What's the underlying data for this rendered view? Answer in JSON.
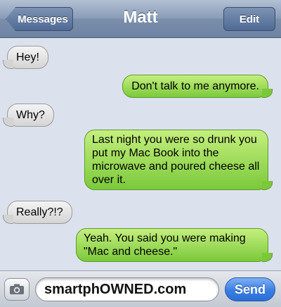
{
  "navbar": {
    "title": "Matt",
    "back_label": "Messages",
    "edit_label": "Edit"
  },
  "messages": [
    {
      "side": "received",
      "text": "Hey!"
    },
    {
      "side": "sent",
      "text": "Don't talk to me anymore."
    },
    {
      "side": "received",
      "text": "Why?"
    },
    {
      "side": "sent",
      "text": "Last night you were so drunk you put my Mac Book into the microwave and poured cheese all over it."
    },
    {
      "side": "received",
      "text": "Really?!?"
    },
    {
      "side": "sent",
      "text": "Yeah. You said you were making \"Mac and cheese.\""
    }
  ],
  "composer": {
    "input_value": "smartphOWNED.com",
    "send_label": "Send",
    "camera_icon": "camera-icon"
  },
  "colors": {
    "navbar": "#7a8eab",
    "background": "#dbe2ed",
    "sent_bubble": "#7bc93b",
    "received_bubble": "#e4e4e4",
    "send_button": "#3a7ee3"
  }
}
